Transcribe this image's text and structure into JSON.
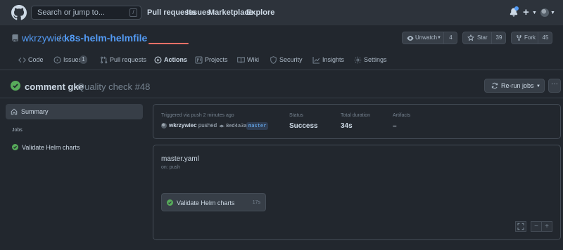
{
  "header": {
    "search_placeholder": "Search or jump to...",
    "search_shortcut": "/",
    "nav": [
      "Pull requests",
      "Issues",
      "Marketplace",
      "Explore"
    ],
    "plus": "+"
  },
  "repo": {
    "owner": "wkrzywiec",
    "separator": "/",
    "name": "k8s-helm-helmfile",
    "watch_label": "Unwatch",
    "watch_count": "4",
    "star_label": "Star",
    "star_count": "39",
    "fork_label": "Fork",
    "fork_count": "45"
  },
  "tabs": [
    {
      "label": "Code",
      "icon": "code-icon"
    },
    {
      "label": "Issues",
      "count": "1",
      "icon": "issue-icon"
    },
    {
      "label": "Pull requests",
      "icon": "pull-request-icon"
    },
    {
      "label": "Actions",
      "icon": "play-icon",
      "active": true
    },
    {
      "label": "Projects",
      "icon": "project-icon"
    },
    {
      "label": "Wiki",
      "icon": "book-icon"
    },
    {
      "label": "Security",
      "icon": "shield-icon"
    },
    {
      "label": "Insights",
      "icon": "graph-icon"
    },
    {
      "label": "Settings",
      "icon": "gear-icon"
    }
  ],
  "run": {
    "commit_title": "comment gke",
    "workflow_run": "Quality check #48",
    "rerun_label": "Re-run jobs",
    "more_label": "···"
  },
  "sidebar": {
    "summary_label": "Summary",
    "jobs_heading": "Jobs",
    "jobs": [
      "Validate Helm charts"
    ]
  },
  "summary": {
    "trigger_text": "Triggered via push 2 minutes ago",
    "actor": "wkrzywiec",
    "action": "pushed",
    "commit_sha": "8ed4a3a",
    "branch": "master",
    "status_label": "Status",
    "status_value": "Success",
    "duration_label": "Total duration",
    "duration_value": "34s",
    "artifacts_label": "Artifacts",
    "artifacts_value": "–"
  },
  "workflow": {
    "file": "master.yaml",
    "trigger": "on: push",
    "job_name": "Validate Helm charts",
    "job_duration": "17s",
    "zoom_minus": "−",
    "zoom_plus": "+"
  },
  "colors": {
    "background": "#22272e",
    "header": "#2d333b",
    "link": "#539bf5",
    "success": "#57ab5a",
    "active_tab": "#f47067"
  }
}
